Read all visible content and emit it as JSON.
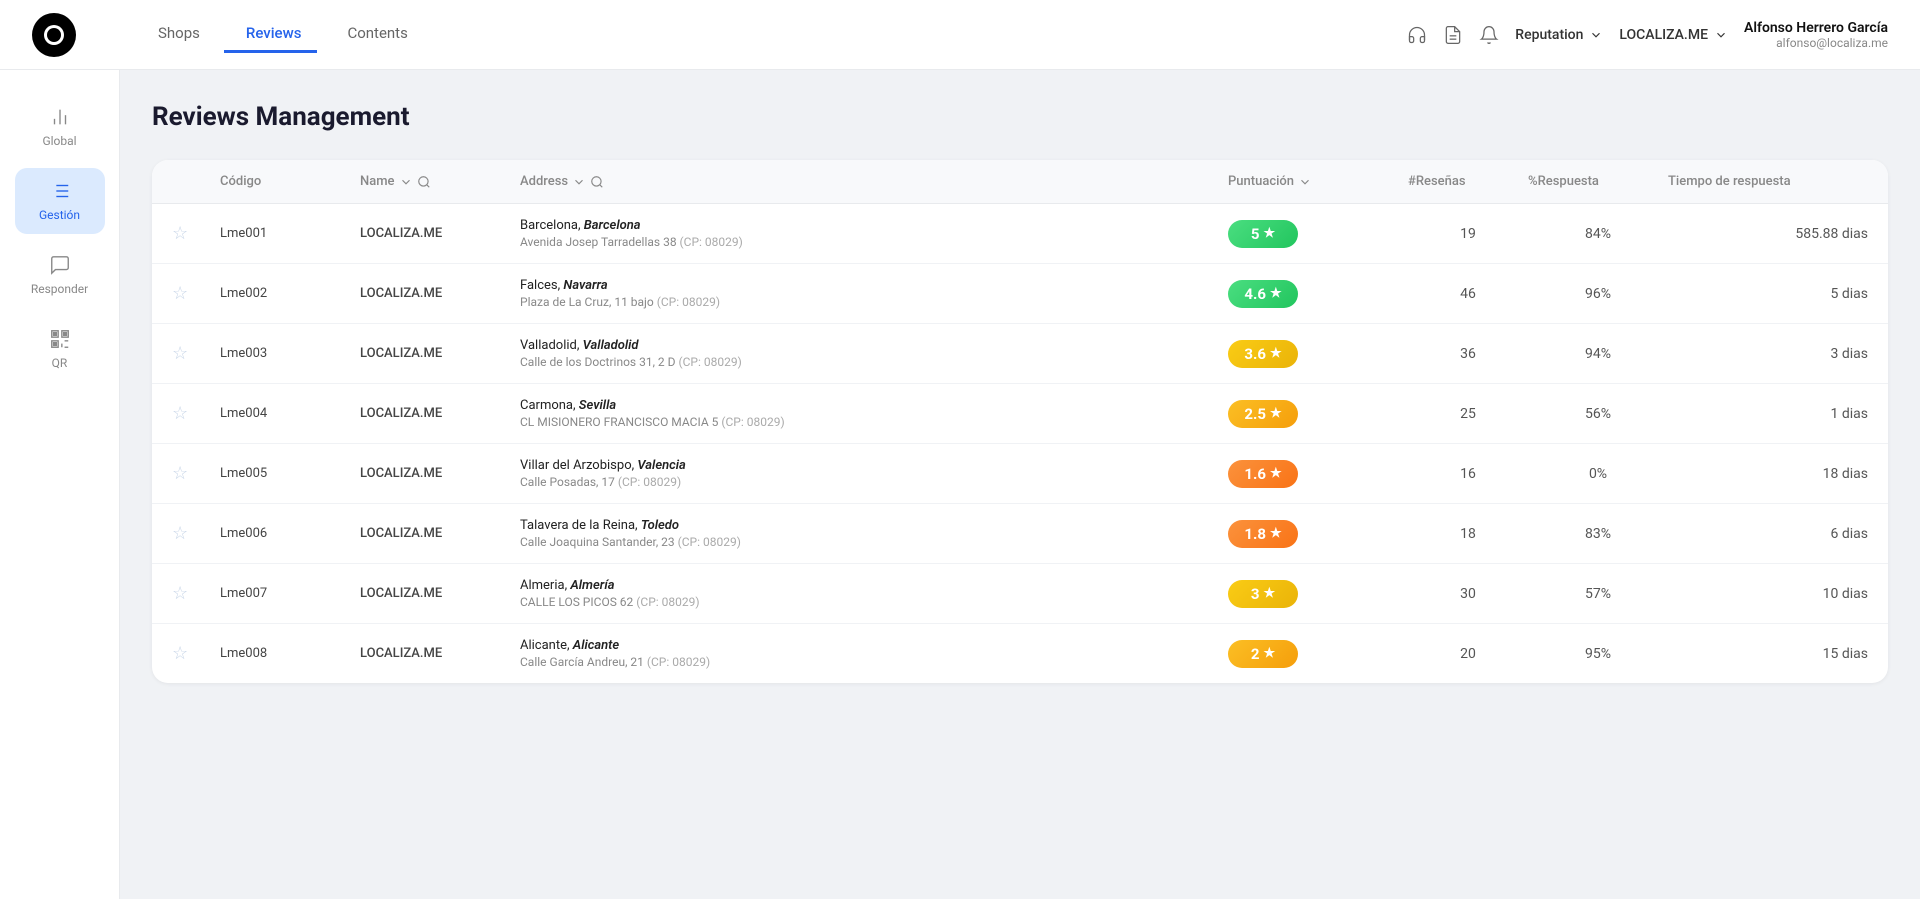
{
  "app": {
    "logo_alt": "Localiza.me logo"
  },
  "nav": {
    "links": [
      {
        "id": "shops",
        "label": "Shops",
        "icon": "shop",
        "active": false
      },
      {
        "id": "reviews",
        "label": "Reviews",
        "icon": "star",
        "active": true
      },
      {
        "id": "contents",
        "label": "Contents",
        "icon": "file",
        "active": false
      }
    ],
    "right": {
      "icon1": "headphones",
      "icon2": "document",
      "icon3": "bell",
      "reputation_label": "Reputation",
      "localiza_label": "LOCALIZA.ME",
      "user_name": "Alfonso Herrero García",
      "user_email": "alfonso@localiza.me"
    }
  },
  "sidebar": {
    "items": [
      {
        "id": "global",
        "label": "Global",
        "active": false
      },
      {
        "id": "gestion",
        "label": "Gestión",
        "active": true
      },
      {
        "id": "responder",
        "label": "Responder",
        "active": false
      },
      {
        "id": "qr",
        "label": "QR",
        "active": false
      }
    ]
  },
  "page": {
    "title": "Reviews Management"
  },
  "table": {
    "columns": [
      {
        "id": "star",
        "label": ""
      },
      {
        "id": "code",
        "label": "Código"
      },
      {
        "id": "name",
        "label": "Name"
      },
      {
        "id": "address",
        "label": "Address"
      },
      {
        "id": "score",
        "label": "Puntuación"
      },
      {
        "id": "reviews",
        "label": "#Reseñas"
      },
      {
        "id": "response",
        "label": "%Respuesta"
      },
      {
        "id": "time",
        "label": "Tiempo de respuesta"
      }
    ],
    "rows": [
      {
        "code": "Lme001",
        "name": "LOCALIZA.ME",
        "address_city": "Barcelona,",
        "address_city_italic": "Barcelona",
        "address_street": "Avenida Josep Tarradellas 38",
        "address_cp": "(CP: 08029)",
        "score": "5",
        "score_class": "score-5",
        "reviews": "19",
        "response": "84%",
        "time": "585.88 dias"
      },
      {
        "code": "Lme002",
        "name": "LOCALIZA.ME",
        "address_city": "Falces,",
        "address_city_italic": "Navarra",
        "address_street": "Plaza de La Cruz, 11 bajo",
        "address_cp": "(CP: 08029)",
        "score": "4.6",
        "score_class": "score-4-6",
        "reviews": "46",
        "response": "96%",
        "time": "5 dias"
      },
      {
        "code": "Lme003",
        "name": "LOCALIZA.ME",
        "address_city": "Valladolid,",
        "address_city_italic": "Valladolid",
        "address_street": "Calle de los Doctrinos 31, 2 D",
        "address_cp": "(CP: 08029)",
        "score": "3.6",
        "score_class": "score-3-6",
        "reviews": "36",
        "response": "94%",
        "time": "3 dias"
      },
      {
        "code": "Lme004",
        "name": "LOCALIZA.ME",
        "address_city": "Carmona,",
        "address_city_italic": "Sevilla",
        "address_street": "CL MISIONERO FRANCISCO MACIA 5",
        "address_cp": "(CP: 08029)",
        "score": "2.5",
        "score_class": "score-2-5",
        "reviews": "25",
        "response": "56%",
        "time": "1 dias"
      },
      {
        "code": "Lme005",
        "name": "LOCALIZA.ME",
        "address_city": "Villar del Arzobispo,",
        "address_city_italic": "Valencia",
        "address_street": "Calle Posadas, 17",
        "address_cp": "(CP: 08029)",
        "score": "1.6",
        "score_class": "score-1-6",
        "reviews": "16",
        "response": "0%",
        "time": "18 dias"
      },
      {
        "code": "Lme006",
        "name": "LOCALIZA.ME",
        "address_city": "Talavera de la Reina,",
        "address_city_italic": "Toledo",
        "address_street": "Calle Joaquina Santander, 23",
        "address_cp": "(CP: 08029)",
        "score": "1.8",
        "score_class": "score-1-8",
        "reviews": "18",
        "response": "83%",
        "time": "6 dias"
      },
      {
        "code": "Lme007",
        "name": "LOCALIZA.ME",
        "address_city": "Almeria,",
        "address_city_italic": "Almería",
        "address_street": "CALLE LOS PICOS 62",
        "address_cp": "(CP: 08029)",
        "score": "3",
        "score_class": "score-3",
        "reviews": "30",
        "response": "57%",
        "time": "10 dias"
      },
      {
        "code": "Lme008",
        "name": "LOCALIZA.ME",
        "address_city": "Alicante,",
        "address_city_italic": "Alicante",
        "address_street": "Calle García Andreu, 21",
        "address_cp": "(CP: 08029)",
        "score": "2",
        "score_class": "score-2",
        "reviews": "20",
        "response": "95%",
        "time": "15 dias"
      }
    ]
  }
}
